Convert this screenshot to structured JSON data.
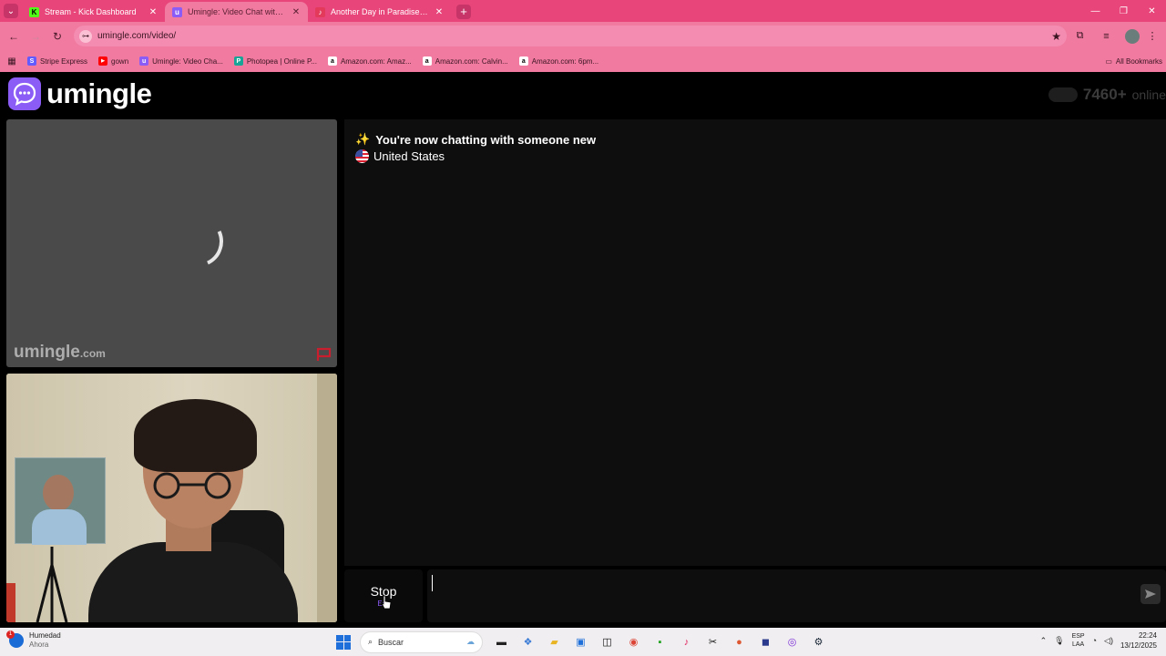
{
  "browser": {
    "tabs": [
      {
        "title": "Stream - Kick Dashboard",
        "favicon": "K",
        "favicon_color": "#53fc18"
      },
      {
        "title": "Umingle: Video Chat with S",
        "favicon": "u",
        "favicon_color": "#8b5cf6"
      },
      {
        "title": "Another Day in Paradise (2016 R",
        "favicon": "♪",
        "favicon_color": "#e33a5c"
      }
    ],
    "url": "umingle.com/video/",
    "bookmarks": [
      {
        "label": "Stripe Express",
        "icon_color": "#635bff",
        "icon": "S"
      },
      {
        "label": "gown",
        "icon_color": "#ff0000",
        "icon": "▶"
      },
      {
        "label": "Umingle: Video Cha...",
        "icon_color": "#8b5cf6",
        "icon": "u"
      },
      {
        "label": "Photopea | Online P...",
        "icon_color": "#18a497",
        "icon": "P"
      },
      {
        "label": "Amazon.com: Amaz...",
        "icon_color": "#ffffff",
        "icon": "a"
      },
      {
        "label": "Amazon.com: Calvin...",
        "icon_color": "#ffffff",
        "icon": "a"
      },
      {
        "label": "Amazon.com: 6pm...",
        "icon_color": "#ffffff",
        "icon": "a"
      }
    ],
    "all_bookmarks": "All Bookmarks"
  },
  "app": {
    "logo_text": "umingle",
    "online_count": "7460+",
    "online_label": "online",
    "watermark_main": "umingle",
    "watermark_suffix": ".com",
    "chat_status": "You're now chatting with someone new",
    "chat_status_icon": "✨",
    "country": "United States",
    "stop_label": "Stop",
    "stop_key": "Esc",
    "accent": "#8b5cf6"
  },
  "taskbar": {
    "weather_title": "Humedad",
    "weather_sub": "Ahora",
    "weather_badge": "1",
    "search_placeholder": "Buscar",
    "lang_top": "ESP",
    "lang_bottom": "LAA",
    "time": "22:24",
    "date": "13/12/2025"
  }
}
